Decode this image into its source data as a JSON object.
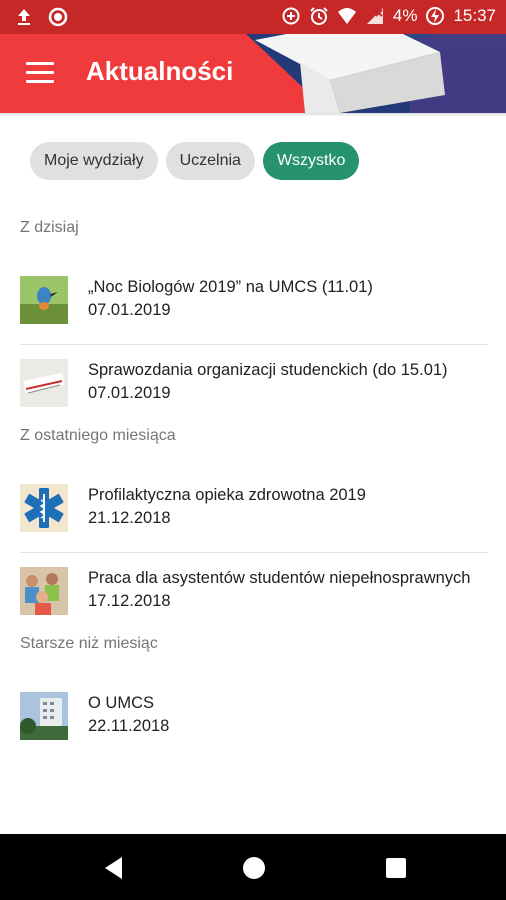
{
  "status_bar": {
    "battery": "4%",
    "time": "15:37"
  },
  "app_bar": {
    "title": "Aktualności"
  },
  "filters": {
    "chips": [
      {
        "label": "Moje wydziały",
        "active": false
      },
      {
        "label": "Uczelnia",
        "active": false
      },
      {
        "label": "Wszystko",
        "active": true
      }
    ]
  },
  "sections": [
    {
      "header": "Z dzisiaj",
      "items": [
        {
          "title": "„Noc Biologów 2019” na UMCS (11.01)",
          "date": "07.01.2019"
        },
        {
          "title": "Sprawozdania organizacji studenckich (do 15.01)",
          "date": "07.01.2019"
        }
      ]
    },
    {
      "header": "Z ostatniego miesiąca",
      "items": [
        {
          "title": "Profilaktyczna opieka zdrowotna 2019",
          "date": "21.12.2018"
        },
        {
          "title": "Praca dla asystentów studentów niepełnosprawnych",
          "date": "17.12.2018"
        }
      ]
    },
    {
      "header": "Starsze niż miesiąc",
      "items": [
        {
          "title": "O UMCS",
          "date": "22.11.2018"
        }
      ]
    }
  ],
  "colors": {
    "app_bar": "#ef3b3b",
    "status_bar": "#c62828",
    "chip_active": "#27926f",
    "chip_inactive": "#e0e0e0"
  }
}
